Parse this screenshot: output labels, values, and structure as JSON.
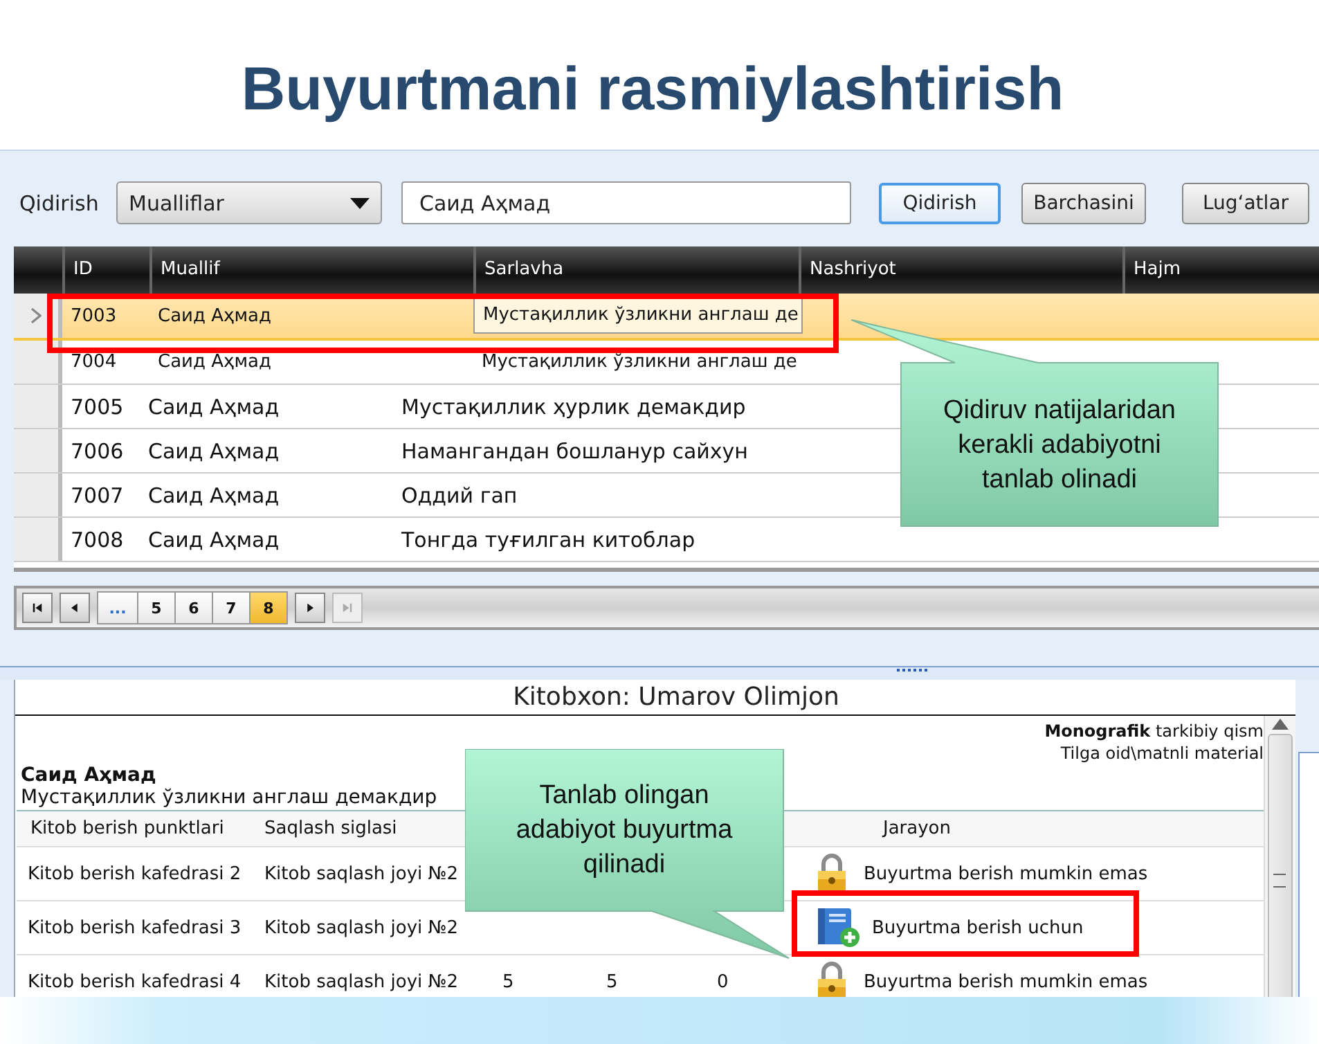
{
  "title": "Buyurtmani rasmiylashtirish",
  "search": {
    "label": "Qidirish",
    "field": {
      "value": "Mualliflar"
    },
    "query": {
      "value": "Саид Аҳмад"
    },
    "buttons": [
      {
        "label": "Qidirish",
        "focused": true
      },
      {
        "label": "Barchasini",
        "focused": false
      },
      {
        "label": "Lug‘atlar",
        "focused": false
      }
    ]
  },
  "results": {
    "columns": [
      "ID",
      "Muallif",
      "Sarlavha",
      "Nashriyot",
      "Hajm"
    ],
    "rows": [
      {
        "kind": "compact",
        "selected": true,
        "id": "7003",
        "author": "Саид Аҳмад",
        "title": "Мустақиллик ўзликни англаш де"
      },
      {
        "kind": "compact",
        "selected": false,
        "id": "7004",
        "author": "Саид Аҳмад",
        "title": "Мустақиллик ўзликни англаш де"
      },
      {
        "kind": "regular",
        "selected": false,
        "id": "7005",
        "author": "Саид Аҳмад",
        "title": "Мустақиллик ҳурлик демакдир"
      },
      {
        "kind": "regular",
        "selected": false,
        "id": "7006",
        "author": "Саид Аҳмад",
        "title": "Намангандан бошланур сайхун"
      },
      {
        "kind": "regular",
        "selected": false,
        "id": "7007",
        "author": "Саид Аҳмад",
        "title": "Оддий гап"
      },
      {
        "kind": "regular",
        "selected": false,
        "id": "7008",
        "author": "Саид Аҳмад",
        "title": "Тонгда туғилган китоблар"
      }
    ]
  },
  "pager": {
    "before": [
      {
        "kind": "first",
        "disabled": false
      },
      {
        "kind": "prev",
        "disabled": false
      }
    ],
    "pages": [
      {
        "label": "...",
        "selected": false
      },
      {
        "label": "5",
        "selected": false
      },
      {
        "label": "6",
        "selected": false
      },
      {
        "label": "7",
        "selected": false
      },
      {
        "label": "8",
        "selected": true
      }
    ],
    "after": [
      {
        "kind": "next",
        "disabled": false
      },
      {
        "kind": "last",
        "disabled": true
      }
    ]
  },
  "reader": {
    "heading": "Kitobxon: Umarov Olimjon",
    "legend": [
      "**Monografik** tarkibiy qism",
      "Tilga oid\\matnli material"
    ],
    "author": "Саид Аҳмад",
    "book_title": "Мустақиллик ўзликни англаш демакдир",
    "columns": [
      "Kitob berish punktlari",
      "Saqlash siglasi"
    ],
    "status_column": "Jarayon",
    "rows": [
      {
        "point": "Kitob berish kafedrasi 2",
        "siglum": "Kitob saqlash joyi №2",
        "kind": "locked",
        "status": "Buyurtma berish mumkin emas"
      },
      {
        "point": "Kitob berish kafedrasi 3",
        "siglum": "Kitob saqlash joyi №2",
        "kind": "available",
        "status": "Buyurtma berish uchun"
      },
      {
        "point": "Kitob berish kafedrasi 4",
        "siglum": "Kitob saqlash joyi №2",
        "values": [
          "5",
          "5",
          "0"
        ],
        "kind": "locked",
        "status": "Buyurtma berish mumkin emas"
      }
    ]
  },
  "callouts": [
    {
      "lines": [
        "Qidiruv natijalaridan",
        "kerakli adabiyotni",
        "tanlab olinadi"
      ]
    },
    {
      "lines": [
        "Tanlab olingan",
        "adabiyot buyurtma",
        "qilinadi"
      ]
    }
  ]
}
